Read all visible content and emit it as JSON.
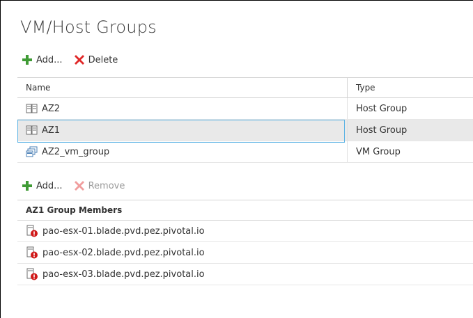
{
  "page": {
    "title": "VM/Host Groups"
  },
  "groups_toolbar": {
    "add_label": "Add...",
    "delete_label": "Delete"
  },
  "groups_table": {
    "columns": [
      "Name",
      "Type"
    ],
    "rows": [
      {
        "name": "AZ2",
        "type": "Host Group",
        "icon": "host-group-icon",
        "selected": false
      },
      {
        "name": "AZ1",
        "type": "Host Group",
        "icon": "host-group-icon",
        "selected": true
      },
      {
        "name": "AZ2_vm_group",
        "type": "VM Group",
        "icon": "vm-group-icon",
        "selected": false
      }
    ]
  },
  "members_toolbar": {
    "add_label": "Add...",
    "remove_label": "Remove"
  },
  "members_table": {
    "header": "AZ1 Group Members",
    "rows": [
      {
        "name": "pao-esx-01.blade.pvd.pez.pivotal.io",
        "icon": "host-error-icon"
      },
      {
        "name": "pao-esx-02.blade.pvd.pez.pivotal.io",
        "icon": "host-error-icon"
      },
      {
        "name": "pao-esx-03.blade.pvd.pez.pivotal.io",
        "icon": "host-error-icon"
      }
    ]
  },
  "colors": {
    "add_icon": "#3f9b35",
    "delete_icon": "#e02828",
    "selection_border": "#5ab2e4",
    "selection_bg": "#e9e9e9",
    "error_badge": "#d01818"
  }
}
